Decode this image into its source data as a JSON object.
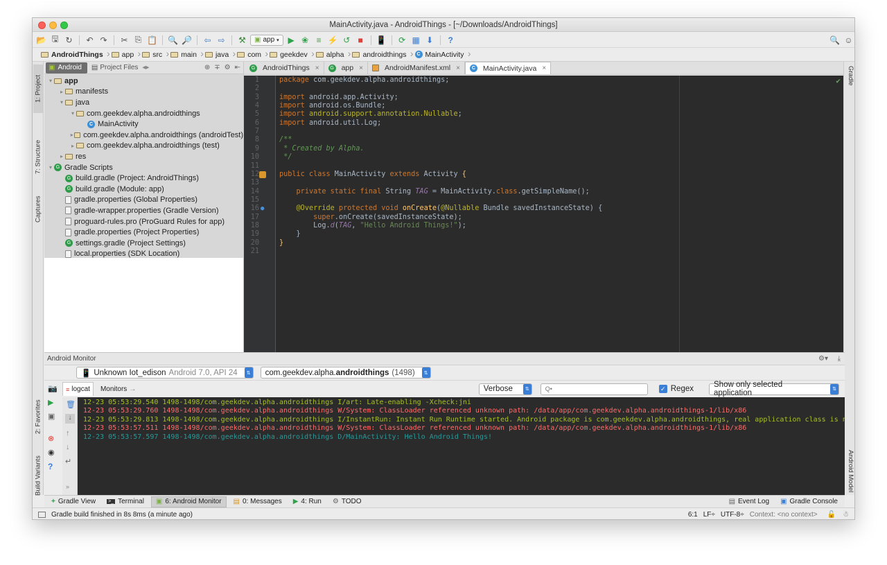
{
  "window": {
    "title": "MainActivity.java - AndroidThings - [~/Downloads/AndroidThings]"
  },
  "toolbar": {
    "run_config": "app"
  },
  "breadcrumbs": [
    "AndroidThings",
    "app",
    "src",
    "main",
    "java",
    "com",
    "geekdev",
    "alpha",
    "androidthings",
    "MainActivity"
  ],
  "left_tabs": {
    "project": "1: Project",
    "structure": "7: Structure",
    "captures": "Captures",
    "favorites": "2: Favorites",
    "build_variants": "Build Variants"
  },
  "right_tabs": {
    "gradle": "Gradle",
    "android_model": "Android Model"
  },
  "project_panel": {
    "view_tab": "Android",
    "files_tab": "Project Files",
    "tree": [
      {
        "label": "app",
        "depth": 0,
        "arrow": "▾",
        "icon": "folder",
        "bold": true
      },
      {
        "label": "manifests",
        "depth": 1,
        "arrow": "▸",
        "icon": "folder"
      },
      {
        "label": "java",
        "depth": 1,
        "arrow": "▾",
        "icon": "folder"
      },
      {
        "label": "com.geekdev.alpha.androidthings",
        "depth": 2,
        "arrow": "▾",
        "icon": "folder"
      },
      {
        "label": "MainActivity",
        "depth": 3,
        "arrow": "",
        "icon": "class"
      },
      {
        "label": "com.geekdev.alpha.androidthings (androidTest)",
        "depth": 2,
        "arrow": "▸",
        "icon": "folder"
      },
      {
        "label": "com.geekdev.alpha.androidthings (test)",
        "depth": 2,
        "arrow": "▸",
        "icon": "folder"
      },
      {
        "label": "res",
        "depth": 1,
        "arrow": "▸",
        "icon": "folder"
      },
      {
        "label": "Gradle Scripts",
        "depth": 0,
        "arrow": "▾",
        "icon": "gradle"
      },
      {
        "label": "build.gradle (Project: AndroidThings)",
        "depth": 1,
        "arrow": "",
        "icon": "gradle"
      },
      {
        "label": "build.gradle (Module: app)",
        "depth": 1,
        "arrow": "",
        "icon": "gradle"
      },
      {
        "label": "gradle.properties (Global Properties)",
        "depth": 1,
        "arrow": "",
        "icon": "file"
      },
      {
        "label": "gradle-wrapper.properties (Gradle Version)",
        "depth": 1,
        "arrow": "",
        "icon": "file"
      },
      {
        "label": "proguard-rules.pro (ProGuard Rules for app)",
        "depth": 1,
        "arrow": "",
        "icon": "file"
      },
      {
        "label": "gradle.properties (Project Properties)",
        "depth": 1,
        "arrow": "",
        "icon": "file"
      },
      {
        "label": "settings.gradle (Project Settings)",
        "depth": 1,
        "arrow": "",
        "icon": "gradle"
      },
      {
        "label": "local.properties (SDK Location)",
        "depth": 1,
        "arrow": "",
        "icon": "file"
      }
    ]
  },
  "editor_tabs": [
    {
      "label": "AndroidThings",
      "icon": "gradle",
      "active": false
    },
    {
      "label": "app",
      "icon": "gradle",
      "active": false
    },
    {
      "label": "AndroidManifest.xml",
      "icon": "xml",
      "active": false
    },
    {
      "label": "MainActivity.java",
      "icon": "class",
      "active": true
    }
  ],
  "code": {
    "line_numbers": [
      "1",
      "2",
      "3",
      "4",
      "5",
      "6",
      "7",
      "8",
      "9",
      "10",
      "11",
      "12",
      "13",
      "14",
      "15",
      "16",
      "17",
      "18",
      "19",
      "20",
      "21"
    ],
    "lines": [
      [
        [
          "kw",
          "package "
        ],
        [
          "pkg",
          "com.geekdev.alpha.androidthings;"
        ]
      ],
      [],
      [
        [
          "kw",
          "import "
        ],
        [
          "pkg",
          "android.app.Activity;"
        ]
      ],
      [
        [
          "kw",
          "import "
        ],
        [
          "pkg",
          "android.os.Bundle;"
        ]
      ],
      [
        [
          "kw",
          "import "
        ],
        [
          "ann",
          "android.support.annotation.Nullable"
        ],
        [
          "pkg",
          ";"
        ]
      ],
      [
        [
          "kw",
          "import "
        ],
        [
          "pkg",
          "android.util.Log;"
        ]
      ],
      [],
      [
        [
          "cmt",
          "/**"
        ]
      ],
      [
        [
          "cmt",
          " * Created by Alpha."
        ]
      ],
      [
        [
          "cmt",
          " */"
        ]
      ],
      [],
      [
        [
          "kw",
          "public class "
        ],
        [
          "pkg",
          "MainActivity "
        ],
        [
          "kw",
          "extends "
        ],
        [
          "pkg",
          "Activity "
        ],
        [
          "fn",
          "{"
        ]
      ],
      [],
      [
        [
          "pkg",
          "    "
        ],
        [
          "kw",
          "private static final "
        ],
        [
          "pkg",
          "String "
        ],
        [
          "fld",
          "TAG"
        ],
        [
          "pkg",
          " = MainActivity."
        ],
        [
          "kw",
          "class"
        ],
        [
          "pkg",
          ".getSimpleName();"
        ]
      ],
      [],
      [
        [
          "pkg",
          "    "
        ],
        [
          "ann",
          "@Override "
        ],
        [
          "kw",
          "protected void "
        ],
        [
          "fn",
          "onCreate"
        ],
        [
          "pkg",
          "("
        ],
        [
          "ann",
          "@Nullable "
        ],
        [
          "pkg",
          "Bundle savedInstanceState) {"
        ]
      ],
      [
        [
          "pkg",
          "        "
        ],
        [
          "kw",
          "super"
        ],
        [
          "pkg",
          ".onCreate(savedInstanceState);"
        ]
      ],
      [
        [
          "pkg",
          "        Log."
        ],
        [
          "fld",
          "d"
        ],
        [
          "pkg",
          "("
        ],
        [
          "fld",
          "TAG"
        ],
        [
          "pkg",
          ", "
        ],
        [
          "str",
          "\"Hello Android Things!\""
        ],
        [
          "pkg",
          ");"
        ]
      ],
      [
        [
          "pkg",
          "    }"
        ]
      ],
      [
        [
          "fn",
          "}"
        ]
      ],
      []
    ]
  },
  "monitor": {
    "title": "Android Monitor",
    "device": "Unknown Iot_edison",
    "device_detail": "Android 7.0, API 24",
    "process_prefix": "com.geekdev.alpha.",
    "process_bold": "androidthings",
    "process_pid": "(1498)",
    "tab_logcat": "logcat",
    "tab_monitors": "Monitors",
    "level": "Verbose",
    "search_placeholder": "Q•",
    "regex_label": "Regex",
    "filter": "Show only selected application",
    "log": [
      {
        "text": "12-23 05:53:29.540 1498-1498/com.geekdev.alpha.androidthings I/art: Late-enabling -Xcheck:jni",
        "color": "#a8c023"
      },
      {
        "text": "12-23 05:53:29.760 1498-1498/com.geekdev.alpha.androidthings W/System: ClassLoader referenced unknown path: /data/app/com.geekdev.alpha.androidthings-1/lib/x86",
        "color": "#ff6b68"
      },
      {
        "text": "12-23 05:53:29.813 1498-1498/com.geekdev.alpha.androidthings I/InstantRun: Instant Run Runtime started. Android package is com.geekdev.alpha.androidthings, real application class is null.",
        "color": "#a8c023"
      },
      {
        "text": "12-23 05:53:57.511 1498-1498/com.geekdev.alpha.androidthings W/System: ClassLoader referenced unknown path: /data/app/com.geekdev.alpha.androidthings-1/lib/x86",
        "color": "#ff6b68"
      },
      {
        "text": "12-23 05:53:57.597 1498-1498/com.geekdev.alpha.androidthings D/MainActivity: Hello Android Things!",
        "color": "#299999"
      }
    ]
  },
  "tool_tabs": {
    "gradle_view": "Gradle View",
    "terminal": "Terminal",
    "android_monitor": "6: Android Monitor",
    "messages": "0: Messages",
    "run": "4: Run",
    "todo": "TODO",
    "event_log": "Event Log",
    "gradle_console": "Gradle Console"
  },
  "status": {
    "message": "Gradle build finished in 8s 8ms (a minute ago)",
    "position": "6:1",
    "line_sep": "LF÷",
    "encoding": "UTF-8÷",
    "context": "Context: <no context>"
  }
}
